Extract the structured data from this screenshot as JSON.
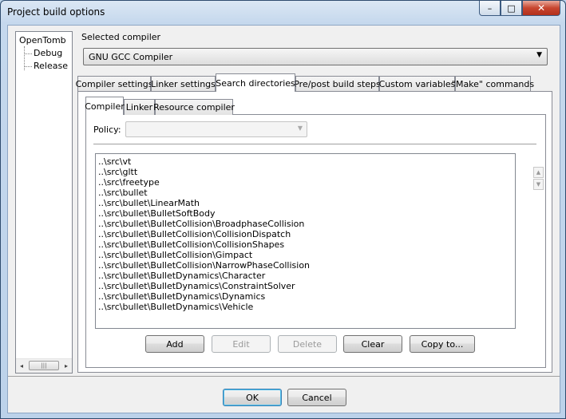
{
  "window": {
    "title": "Project build options",
    "controls": {
      "minimize": "–",
      "maximize": "□",
      "close": "✕"
    }
  },
  "tree": {
    "root": "OpenTomb",
    "children": [
      "Debug",
      "Release"
    ],
    "scroll_left": "◂",
    "scroll_right": "▸",
    "scroll_thumb": "|||"
  },
  "selected_compiler": {
    "label": "Selected compiler",
    "value": "GNU GCC Compiler",
    "arrow": "▼"
  },
  "tabs": [
    {
      "label": "Compiler settings"
    },
    {
      "label": "Linker settings"
    },
    {
      "label": "Search directories",
      "active": true
    },
    {
      "label": "Pre/post build steps"
    },
    {
      "label": "Custom variables"
    },
    {
      "label": "\"Make\" commands"
    }
  ],
  "subtabs": [
    {
      "label": "Compiler",
      "active": true
    },
    {
      "label": "Linker"
    },
    {
      "label": "Resource compiler"
    }
  ],
  "policy": {
    "label": "Policy:",
    "value": "",
    "arrow": "▼"
  },
  "directories": [
    "..\\src\\vt",
    "..\\src\\gltt",
    "..\\src\\freetype",
    "..\\src\\bullet",
    "..\\src\\bullet\\LinearMath",
    "..\\src\\bullet\\BulletSoftBody",
    "..\\src\\bullet\\BulletCollision\\BroadphaseCollision",
    "..\\src\\bullet\\BulletCollision\\CollisionDispatch",
    "..\\src\\bullet\\BulletCollision\\CollisionShapes",
    "..\\src\\bullet\\BulletCollision\\Gimpact",
    "..\\src\\bullet\\BulletCollision\\NarrowPhaseCollision",
    "..\\src\\bullet\\BulletDynamics\\Character",
    "..\\src\\bullet\\BulletDynamics\\ConstraintSolver",
    "..\\src\\bullet\\BulletDynamics\\Dynamics",
    "..\\src\\bullet\\BulletDynamics\\Vehicle"
  ],
  "move_buttons": {
    "up": "▲",
    "down": "▼"
  },
  "actions": {
    "add": "Add",
    "edit": "Edit",
    "delete": "Delete",
    "clear": "Clear",
    "copy_to": "Copy to..."
  },
  "dialog": {
    "ok": "OK",
    "cancel": "Cancel"
  }
}
